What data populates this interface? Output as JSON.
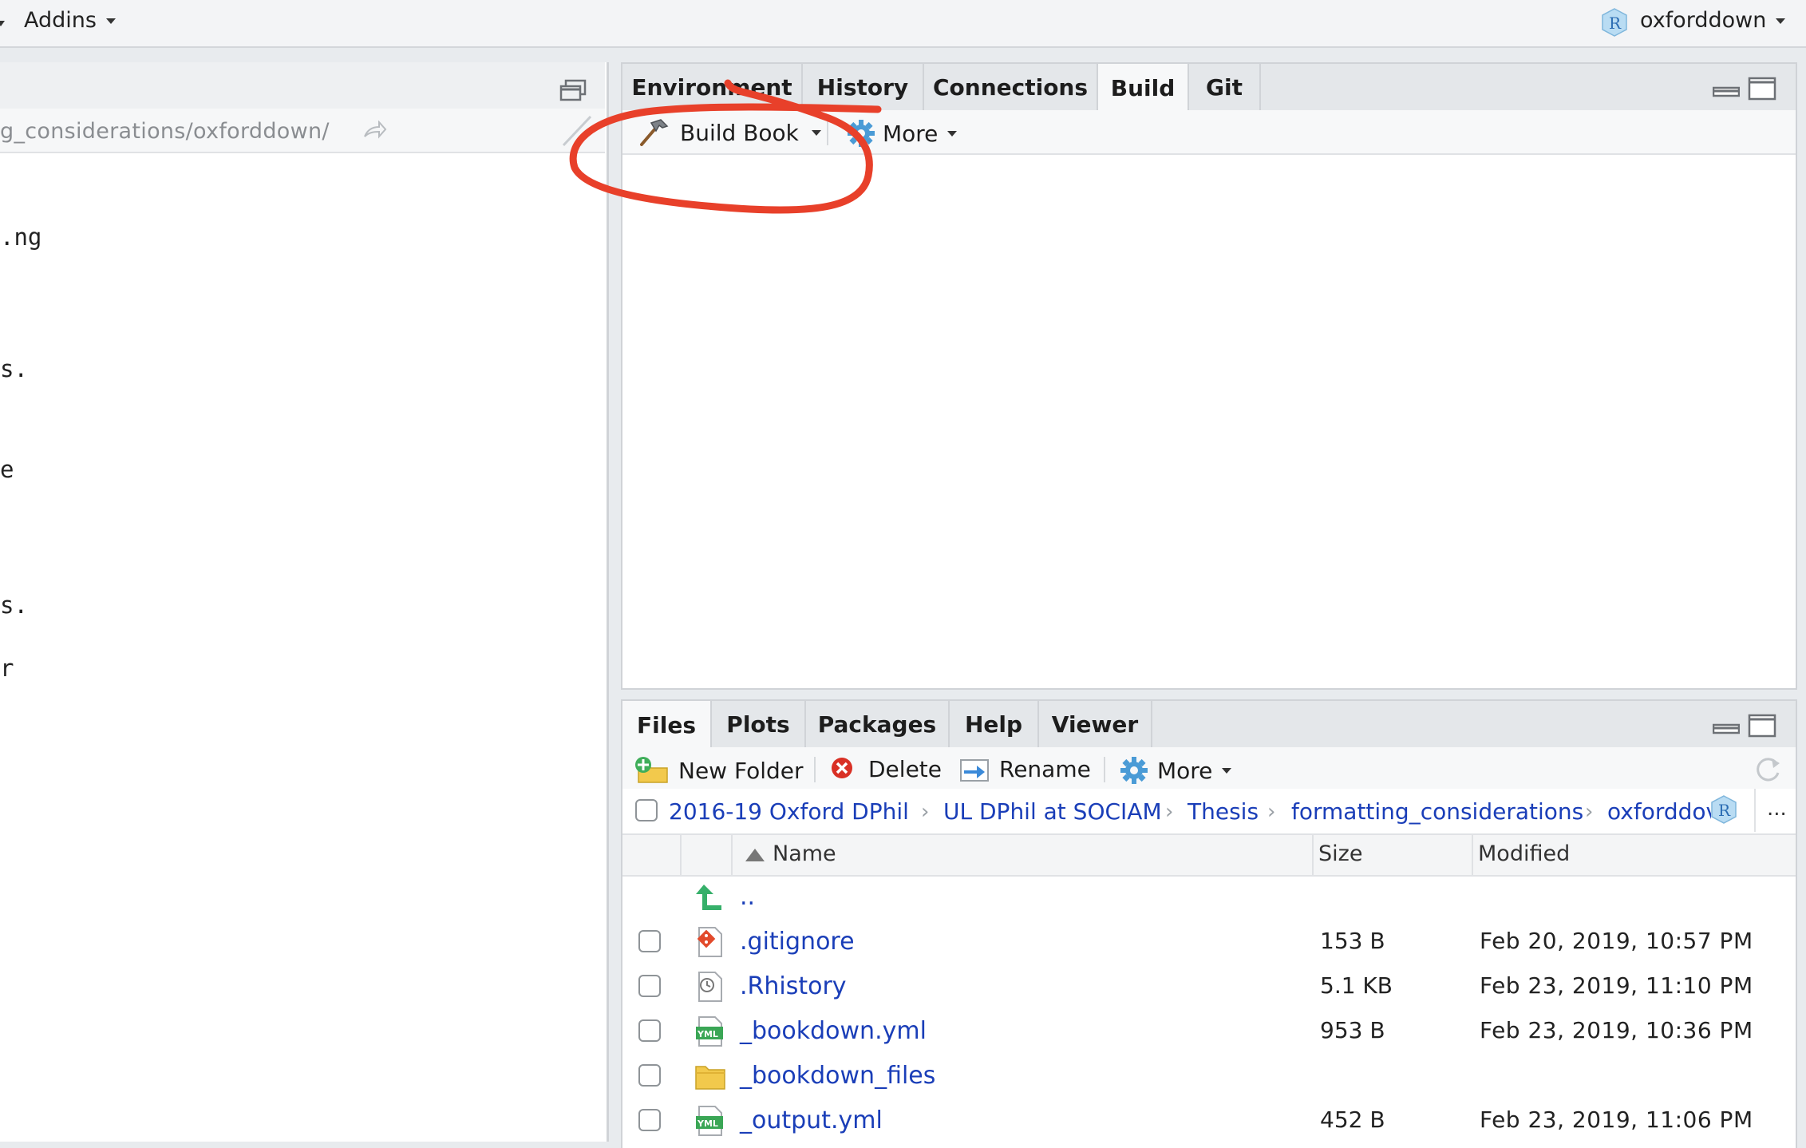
{
  "menubar": {
    "addins_label": "Addins",
    "project_name": "oxforddown"
  },
  "left_pane": {
    "path": "g_considerations/oxforddown/",
    "code_fragments": [
      ".ng",
      "s.",
      "e",
      "s.",
      "r"
    ]
  },
  "top_right_pane": {
    "tabs": [
      "Environment",
      "History",
      "Connections",
      "Build",
      "Git"
    ],
    "active_tab": "Build",
    "toolbar": {
      "build_book_label": "Build Book",
      "more_label": "More"
    }
  },
  "files_pane": {
    "tabs": [
      "Files",
      "Plots",
      "Packages",
      "Help",
      "Viewer"
    ],
    "active_tab": "Files",
    "toolbar": {
      "new_folder_label": "New Folder",
      "delete_label": "Delete",
      "rename_label": "Rename",
      "more_label": "More"
    },
    "breadcrumbs": [
      "2016-19 Oxford DPhil",
      "UL DPhil at SOCIAM",
      "Thesis",
      "formatting_considerations",
      "oxforddov"
    ],
    "breadcrumb_overflow": "...",
    "columns": {
      "name": "Name",
      "size": "Size",
      "modified": "Modified"
    },
    "parent_dir_label": "..",
    "files": [
      {
        "name": ".gitignore",
        "size": "153 B",
        "modified": "Feb 20, 2019, 10:57 PM",
        "icon": "git-file-icon"
      },
      {
        "name": ".Rhistory",
        "size": "5.1 KB",
        "modified": "Feb 23, 2019, 11:10 PM",
        "icon": "history-file-icon"
      },
      {
        "name": "_bookdown.yml",
        "size": "953 B",
        "modified": "Feb 23, 2019, 10:36 PM",
        "icon": "yml-file-icon"
      },
      {
        "name": "_bookdown_files",
        "size": "",
        "modified": "",
        "icon": "folder-icon"
      },
      {
        "name": "_output.yml",
        "size": "452 B",
        "modified": "Feb 23, 2019, 11:06 PM",
        "icon": "yml-file-icon"
      }
    ]
  },
  "annotation": {
    "color": "#e8402a"
  }
}
